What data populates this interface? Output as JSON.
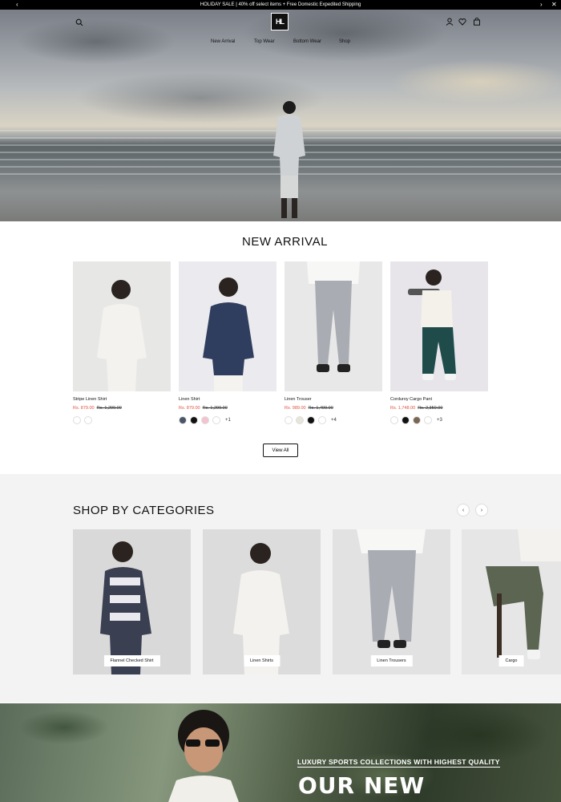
{
  "announcement": {
    "text": "HOLIDAY SALE | 40% off select items + Free Domestic Expedited Shipping",
    "prev": "‹",
    "next": "›",
    "close": "✕"
  },
  "header": {
    "logo": "HL",
    "nav": [
      "New Arrival",
      "Top Wear",
      "Bottom Wear",
      "Shop"
    ]
  },
  "new_arrival": {
    "title": "NEW ARRIVAL",
    "products": [
      {
        "name": "Stripe Linen Shirt",
        "price": "Rs. 879.00",
        "was": "Rs. 1,299.00",
        "swatches": [
          "#ffffff",
          "#ffffff"
        ],
        "more": ""
      },
      {
        "name": "Linen Shirt",
        "price": "Rs. 879.00",
        "was": "Rs. 1,299.00",
        "swatches": [
          "#4a5568",
          "#111111",
          "#f4c2d0",
          "#ffffff"
        ],
        "more": "+1"
      },
      {
        "name": "Linen Trouser",
        "price": "Rs. 989.00",
        "was": "Rs. 1,499.00",
        "swatches": [
          "#ffffff",
          "#e9e4d8",
          "#111111",
          "#ffffff"
        ],
        "more": "+4"
      },
      {
        "name": "Corduroy Cargo Pant",
        "price": "Rs. 1,748.00",
        "was": "Rs. 2,350.00",
        "swatches": [
          "#ffffff",
          "#111111",
          "#7a6654",
          "#ffffff"
        ],
        "more": "+3"
      }
    ],
    "view_all": "View All"
  },
  "categories": {
    "title": "SHOP BY CATEGORIES",
    "prev": "‹",
    "next": "›",
    "items": [
      "Flannel Checked Shirt",
      "Linen Shirts",
      "Linen Trousers",
      "Cargo"
    ]
  },
  "banner": {
    "tagline": "LUXURY SPORTS COLLECTIONS WITH HIGHEST QUALITY",
    "headline": "OUR NEW"
  }
}
